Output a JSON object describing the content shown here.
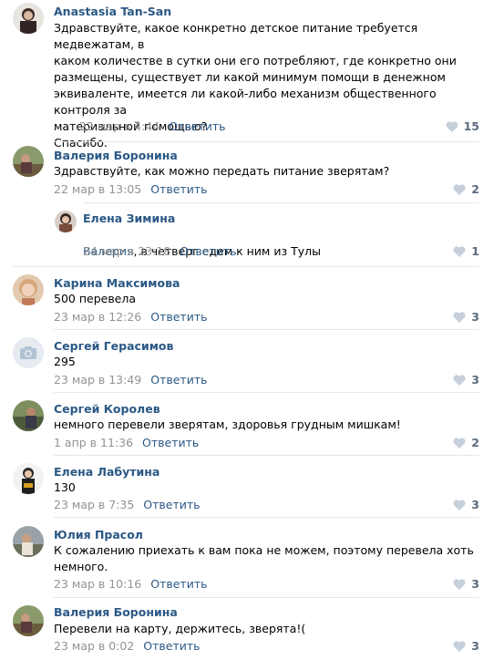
{
  "comments": [
    {
      "author": "Anastasia Tan-San",
      "text": "Здравствуйте, какое конкретно детское питание требуется медвежатам, в\nкаком количестве в сутки они его потребляют, где конкретно они\nразмещены, существует ли какой минимум помощи в денежном\nэквиваленте, имеется ли какой-либо механизм общественного контроля за\nматериальной помощью?\nСпасибо.",
      "date": "22 мар в 4:44",
      "reply_label": "Ответить",
      "likes": "15"
    },
    {
      "author": "Валерия Боронина",
      "text": "Здравствуйте, как можно передать питание зверятам?",
      "date": "22 мар в 13:05",
      "reply_label": "Ответить",
      "likes": "2"
    },
    {
      "author": "Елена Зимина",
      "mention": "Валерия",
      "text": ", в четверг едем к ним из Тулы",
      "date": "24 мар в 23:18",
      "reply_label": "Ответить",
      "likes": "1"
    },
    {
      "author": "Карина Максимова",
      "text": "500 перевела",
      "date": "23 мар в 12:26",
      "reply_label": "Ответить",
      "likes": "3"
    },
    {
      "author": "Сергей Герасимов",
      "text": "295",
      "date": "23 мар в 13:49",
      "reply_label": "Ответить",
      "likes": "3"
    },
    {
      "author": "Сергей Королев",
      "text": "немного перевели зверятам, здоровья грудным мишкам!",
      "date": "1 апр в 11:36",
      "reply_label": "Ответить",
      "likes": "2"
    },
    {
      "author": "Елена Лабутина",
      "text": "130",
      "date": "23 мар в 7:35",
      "reply_label": "Ответить",
      "likes": "3"
    },
    {
      "author": "Юлия Прасол",
      "text": "К сожалению приехать к вам пока не можем, поэтому перевела хоть\nнемного.",
      "date": "23 мар в 10:16",
      "reply_label": "Ответить",
      "likes": "3"
    },
    {
      "author": "Валерия Боронина",
      "text": "Перевели на карту, держитесь, зверята!(",
      "date": "23 мар в 0:02",
      "reply_label": "Ответить",
      "likes": "3"
    }
  ],
  "colors": {
    "link": "#2a5885",
    "meta": "#939393",
    "likes": "#5b6b7c",
    "separator": "#e7e8ec"
  }
}
